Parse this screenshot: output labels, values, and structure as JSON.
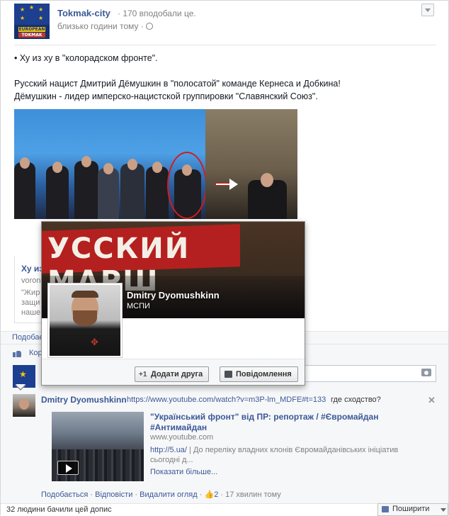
{
  "post": {
    "page_name": "Tokmak-city",
    "likes_count": "· 170 вподобали це.",
    "time": "близько години тому ·",
    "avatar_text": {
      "top": "EUROPEAN",
      "bottom": "TOKMAK"
    },
    "text_lines": [
      "• Ху из ху в \"колорадском фронте\".",
      "Русский нацист Дмитрий Дёмушкин в \"полосатой\" команде Кернеса и Добкина!",
      "Дёмушкин - лидер имперско-нацистской группировки \"Славянский Союз\"."
    ],
    "attachment": {
      "title": "Ху из",
      "domain": "voron",
      "lines": [
        "\"Жир",
        "защи",
        "наше"
      ]
    }
  },
  "actions": {
    "like_label": "Подобає"
  },
  "likes_row": {
    "label": "Кор"
  },
  "hovercard": {
    "cover_text": "УССКИЙ МАРШ",
    "name": "Dmitry Dyomushkinn",
    "subtitle": "МСПИ",
    "add_friend_label": "Додати друга",
    "message_label": "Повідомлення"
  },
  "comment": {
    "author": "Dmitry Dyomushkinn",
    "url": "https://www.youtube.com/watch?v=m3P-lm_MDFE#t=133",
    "rest": "где сходство?",
    "video": {
      "title": "\"Український фронт\" від ПР: репортаж / #Євромайдан #Антимайдан",
      "domain": "www.youtube.com",
      "desc_link": "http://5.ua/",
      "desc": " | До переліку владних клонів Євромайданівських ініціатив сьогодні д...",
      "more": "Показати більше..."
    },
    "actions": {
      "like": "Подобається",
      "reply": "Відповісти",
      "remove_preview": "Видалити огляд",
      "likes": "2",
      "time": "17 хвилин тому"
    }
  },
  "footer": {
    "seen": "32 людини бачили цей допис",
    "share": "Поширити"
  },
  "colors": {
    "link": "#3b5998",
    "muted": "#808080",
    "banner_red": "#b4201f",
    "annotation_red": "#d01d1d"
  }
}
